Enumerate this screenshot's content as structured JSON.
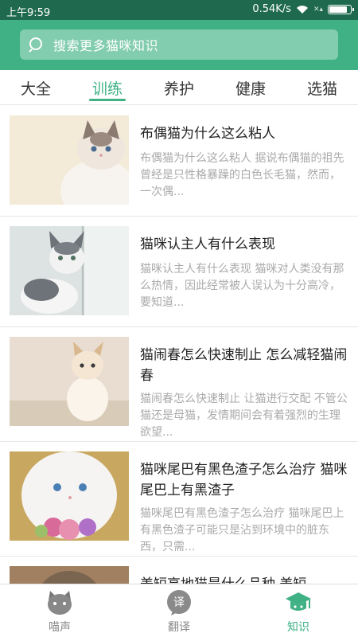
{
  "status": {
    "time": "上午9:59",
    "speed": "0.54K/s"
  },
  "search": {
    "placeholder": "搜索更多猫咪知识"
  },
  "tabs": [
    {
      "label": "大全"
    },
    {
      "label": "训练",
      "active": true
    },
    {
      "label": "养护"
    },
    {
      "label": "健康"
    },
    {
      "label": "选猫"
    }
  ],
  "articles": [
    {
      "title": "布偶猫为什么这么粘人",
      "desc": "布偶猫为什么这么粘人 据说布偶猫的祖先曾经是只性格暴躁的白色长毛猫，然而，一次偶..."
    },
    {
      "title": "猫咪认主人有什么表现",
      "desc": "猫咪认主人有什么表现 猫咪对人类没有那么热情，因此经常被人误认为十分高冷，要知道..."
    },
    {
      "title": "猫闹春怎么快速制止 怎么减轻猫闹春",
      "desc": "猫闹春怎么快速制止 让猫进行交配 不管公猫还是母猫，发情期间会有着强烈的生理欲望..."
    },
    {
      "title": "猫咪尾巴有黑色渣子怎么治疗 猫咪尾巴上有黑渣子",
      "desc": "猫咪尾巴有黑色渣子怎么治疗 猫咪尾巴上有黑色渣子可能只是沾到环境中的脏东西，只需..."
    },
    {
      "title": "美短高地猫是什么品种 美短",
      "desc": ""
    }
  ],
  "bottom_nav": [
    {
      "label": "喵声",
      "icon": "cat-face-icon"
    },
    {
      "label": "翻译",
      "icon": "translate-bubble-icon",
      "glyph": "译"
    },
    {
      "label": "知识",
      "icon": "graduation-cap-icon",
      "active": true
    }
  ],
  "colors": {
    "accent": "#3fb185",
    "status_bar": "#1f6a4f"
  }
}
